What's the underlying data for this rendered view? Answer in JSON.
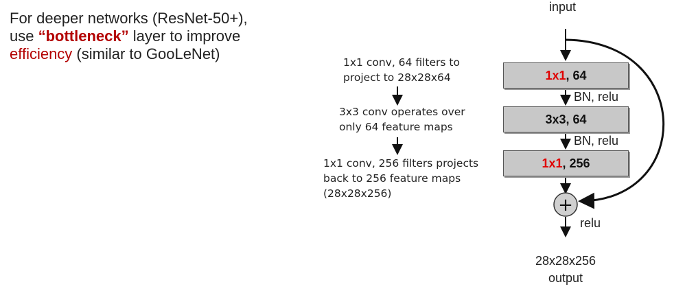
{
  "intro": {
    "line1": "For deeper networks (ResNet-50+),",
    "line2_pre": "use ",
    "line2_bold": "“bottleneck”",
    "line2_post": " layer to improve",
    "line3_red": "efficiency",
    "line3_post": " (similar to GooLeNet)"
  },
  "notes": [
    {
      "lines": [
        "1x1 conv, 64 filters to",
        "project to 28x28x64"
      ]
    },
    {
      "lines": [
        "3x3 conv operates over",
        "only 64 feature maps"
      ]
    },
    {
      "lines": [
        "1x1 conv, 256 filters projects",
        "back to 256 feature maps",
        "(28x28x256)"
      ]
    }
  ],
  "diagram": {
    "input_label": "input",
    "layers": [
      {
        "kernel": "1x1",
        "kernel_color": "#e00000",
        "filters": ", 64"
      },
      {
        "kernel": "3x3",
        "kernel_color": "#111111",
        "filters": ", 64"
      },
      {
        "kernel": "1x1",
        "kernel_color": "#e00000",
        "filters": ", 256"
      }
    ],
    "between_labels": [
      "BN, relu",
      "BN, relu"
    ],
    "add_symbol": "+",
    "relu_label": "relu",
    "output_line1": "28x28x256",
    "output_line2": "output"
  }
}
